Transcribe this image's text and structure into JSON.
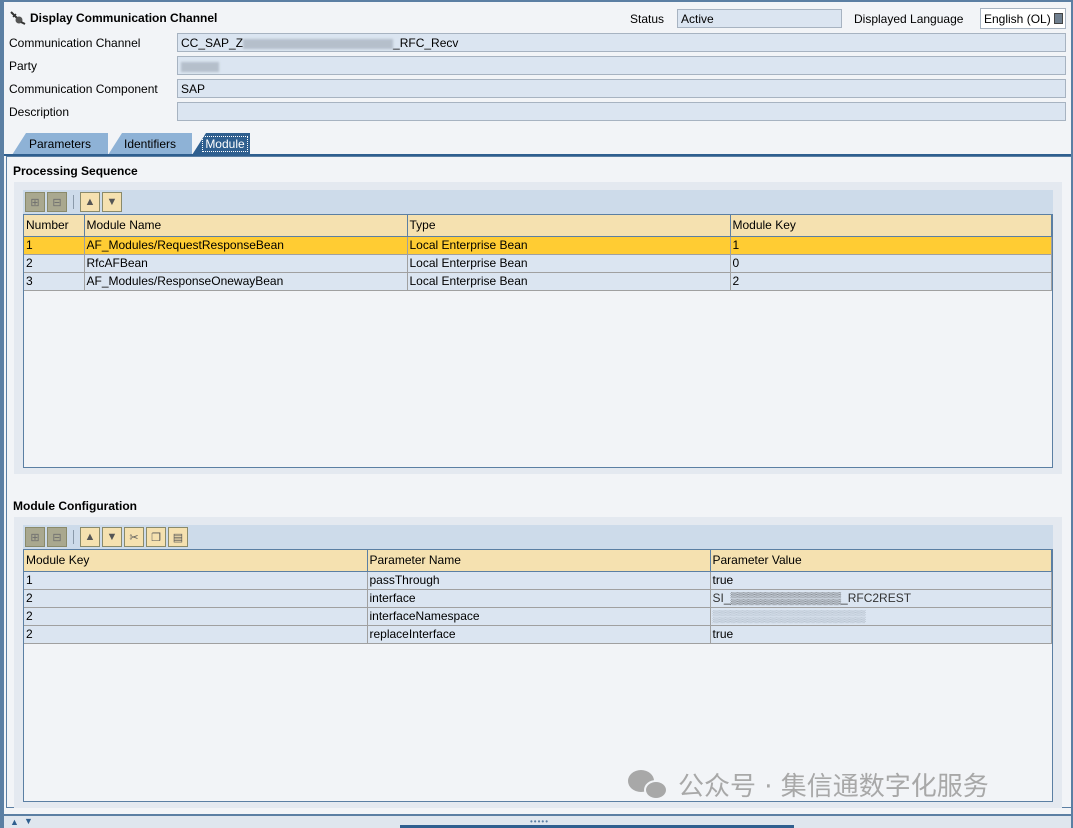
{
  "header": {
    "title": "Display Communication Channel",
    "status_label": "Status",
    "status_value": "Active",
    "language_label": "Displayed Language",
    "language_value": "English (OL)"
  },
  "fields": [
    {
      "label": "Communication Channel",
      "value_prefix": "CC_SAP_Z",
      "value_suffix": "_RFC_Recv",
      "redacted": true
    },
    {
      "label": "Party",
      "value": "",
      "redacted": true
    },
    {
      "label": "Communication Component",
      "value": "SAP"
    },
    {
      "label": "Description",
      "value": ""
    }
  ],
  "tabs": [
    {
      "label": "Parameters",
      "active": false
    },
    {
      "label": "Identifiers",
      "active": false
    },
    {
      "label": "Module",
      "active": true
    }
  ],
  "processing_sequence": {
    "title": "Processing Sequence",
    "toolbar": [
      "insert-row",
      "delete-row",
      "move-up",
      "move-down"
    ],
    "columns": [
      "Number",
      "Module Name",
      "Type",
      "Module Key"
    ],
    "rows": [
      [
        "1",
        "AF_Modules/RequestResponseBean",
        "Local Enterprise Bean",
        "1"
      ],
      [
        "2",
        "RfcAFBean",
        "Local Enterprise Bean",
        "0"
      ],
      [
        "3",
        "AF_Modules/ResponseOnewayBean",
        "Local Enterprise Bean",
        "2"
      ]
    ],
    "selected_row": 0
  },
  "module_configuration": {
    "title": "Module Configuration",
    "toolbar": [
      "insert-row",
      "delete-row",
      "move-up",
      "move-down",
      "cut",
      "copy",
      "paste"
    ],
    "columns": [
      "Module Key",
      "Parameter Name",
      "Parameter Value"
    ],
    "rows": [
      [
        "1",
        "passThrough",
        "true"
      ],
      [
        "2",
        "interface",
        "SI_▒▒▒▒▒▒▒▒▒▒▒▒▒_RFC2REST"
      ],
      [
        "2",
        "interfaceNamespace",
        "▒▒▒▒▒▒▒▒▒▒▒▒▒▒▒▒▒▒"
      ],
      [
        "2",
        "replaceInterface",
        "true"
      ]
    ]
  },
  "watermark": "公众号 · 集信通数字化服务"
}
